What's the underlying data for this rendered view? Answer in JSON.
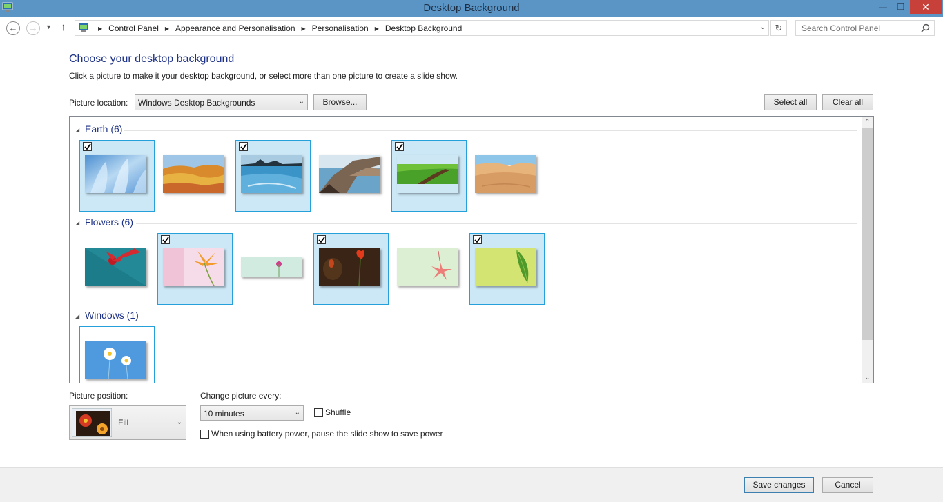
{
  "window": {
    "title": "Desktop Background",
    "minimize_glyph": "—",
    "maximize_glyph": "❐",
    "close_glyph": "✕"
  },
  "nav": {
    "breadcrumbs": [
      "Control Panel",
      "Appearance and Personalisation",
      "Personalisation",
      "Desktop Background"
    ],
    "search_placeholder": "Search Control Panel"
  },
  "page": {
    "heading": "Choose your desktop background",
    "subtext": "Click a picture to make it your desktop background, or select more than one picture to create a slide show.",
    "picture_location_label": "Picture location:",
    "picture_location_value": "Windows Desktop Backgrounds",
    "browse_label": "Browse...",
    "select_all_label": "Select all",
    "clear_all_label": "Clear all"
  },
  "gallery": {
    "groups": [
      {
        "label": "Earth (6)",
        "items": [
          {
            "name": "ice-wallpaper",
            "selected": true
          },
          {
            "name": "painted-hills-wallpaper",
            "selected": false
          },
          {
            "name": "sea-rocks-wallpaper",
            "selected": true
          },
          {
            "name": "coastal-rocks-wallpaper",
            "selected": false
          },
          {
            "name": "green-field-wallpaper",
            "selected": true
          },
          {
            "name": "sand-dunes-wallpaper",
            "selected": false
          }
        ]
      },
      {
        "label": "Flowers (6)",
        "items": [
          {
            "name": "red-flower-teal-wallpaper",
            "selected": false
          },
          {
            "name": "orange-lily-wallpaper",
            "selected": true
          },
          {
            "name": "pink-bud-wallpaper",
            "selected": false
          },
          {
            "name": "red-tulips-wallpaper",
            "selected": true
          },
          {
            "name": "pink-blossom-wallpaper",
            "selected": false
          },
          {
            "name": "green-leaf-wallpaper",
            "selected": true
          }
        ]
      },
      {
        "label": "Windows (1)",
        "items": [
          {
            "name": "daisies-blue-wallpaper",
            "selected": false
          }
        ]
      }
    ]
  },
  "settings": {
    "picture_position_label": "Picture position:",
    "picture_position_value": "Fill",
    "change_every_label": "Change picture every:",
    "change_every_value": "10 minutes",
    "shuffle_label": "Shuffle",
    "shuffle_checked": false,
    "battery_label": "When using battery power, pause the slide show to save power",
    "battery_checked": false
  },
  "footer": {
    "save_label": "Save changes",
    "cancel_label": "Cancel"
  }
}
